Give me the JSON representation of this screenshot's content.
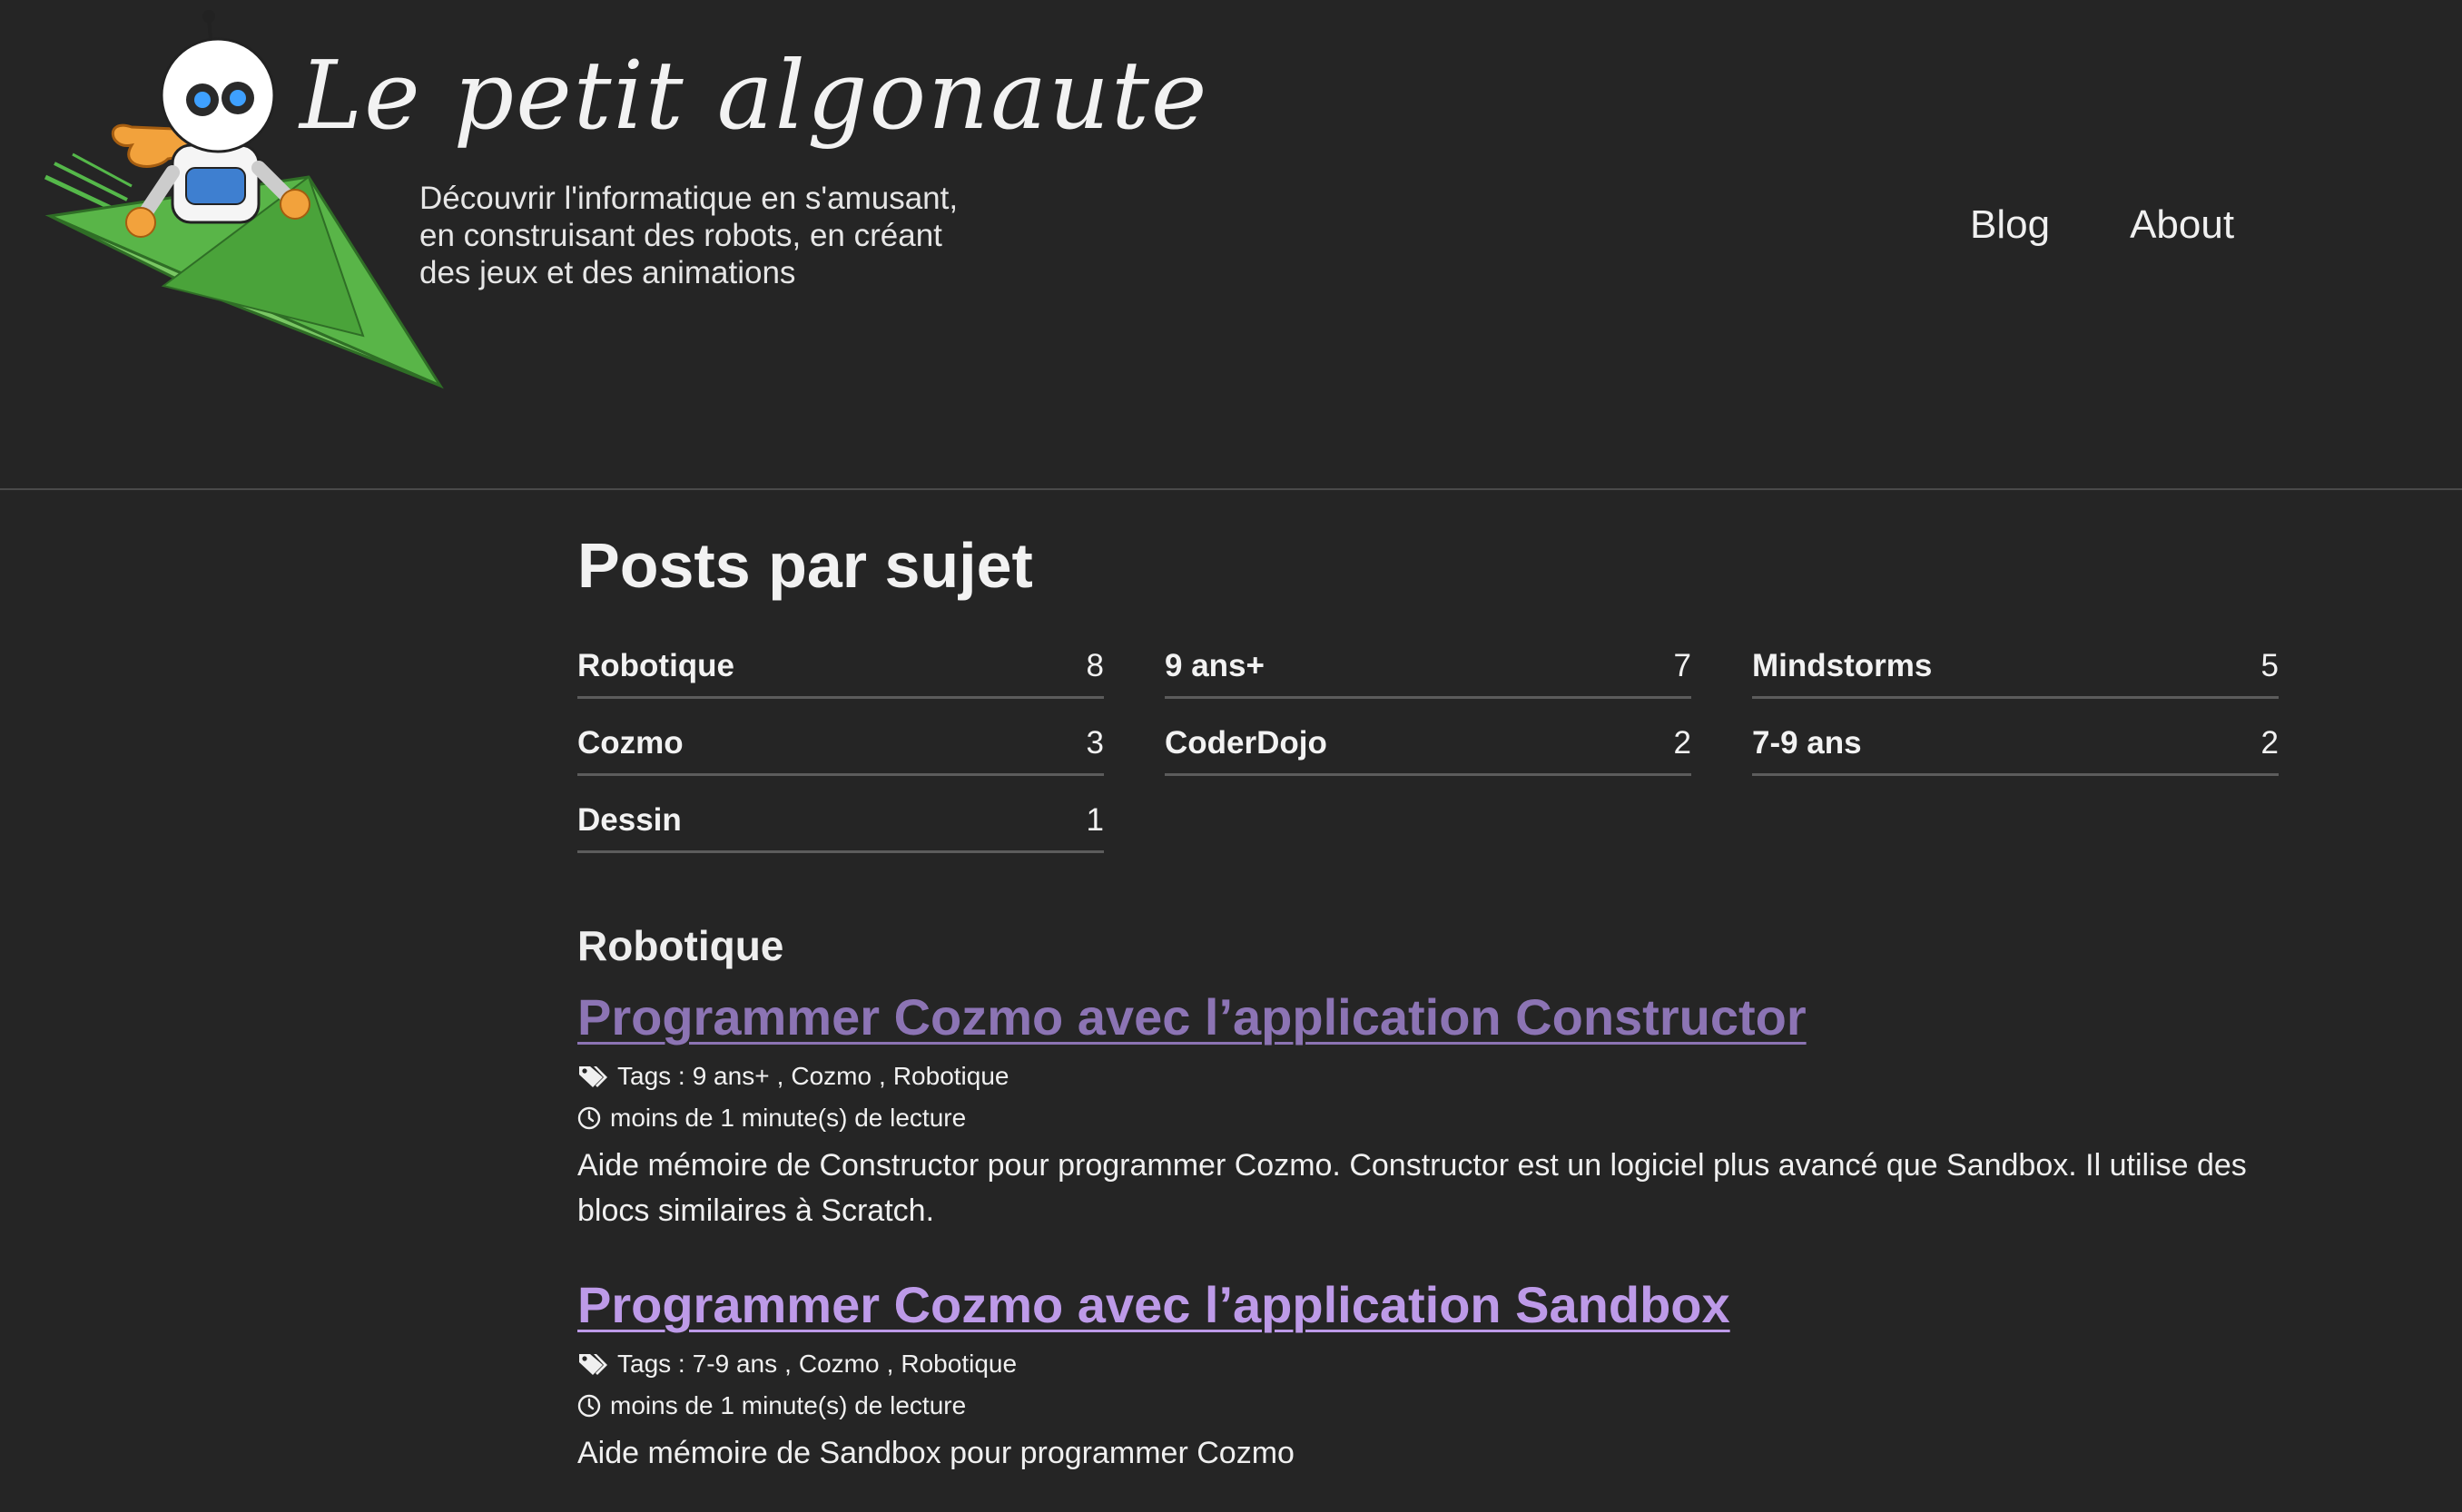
{
  "site": {
    "title": "Le petit algonaute",
    "tagline_lines": [
      "Découvrir l'informatique en s'amusant,",
      "en construisant des robots, en créant",
      "des jeux et des animations"
    ]
  },
  "nav": {
    "items": [
      {
        "label": "Blog"
      },
      {
        "label": "About"
      }
    ]
  },
  "page": {
    "title": "Posts par sujet"
  },
  "tags": [
    {
      "name": "Robotique",
      "count": "8"
    },
    {
      "name": "9 ans+",
      "count": "7"
    },
    {
      "name": "Mindstorms",
      "count": "5"
    },
    {
      "name": "Cozmo",
      "count": "3"
    },
    {
      "name": "CoderDojo",
      "count": "2"
    },
    {
      "name": "7-9 ans",
      "count": "2"
    },
    {
      "name": "Dessin",
      "count": "1"
    }
  ],
  "section": {
    "heading": "Robotique"
  },
  "posts": [
    {
      "title": "Programmer Cozmo avec l’application Constructor",
      "title_color": "#8c74b4",
      "tags_label": "Tags :",
      "tags": [
        "9 ans+",
        "Cozmo",
        "Robotique"
      ],
      "reading_time": "moins de 1 minute(s) de lecture",
      "excerpt": "Aide mémoire de Constructor pour programmer Cozmo. Constructor est un logiciel plus avancé que Sandbox. Il utilise des blocs similaires à Scratch."
    },
    {
      "title": "Programmer Cozmo avec l’application Sandbox",
      "title_color": "#bd9ae8",
      "tags_label": "Tags :",
      "tags": [
        "7-9 ans",
        "Cozmo",
        "Robotique"
      ],
      "reading_time": "moins de 1 minute(s) de lecture",
      "excerpt": "Aide mémoire de Sandbox pour programmer Cozmo"
    }
  ],
  "colors": {
    "background": "#252525",
    "text": "#eeeeee",
    "divider": "#5c5c5c",
    "link_visited": "#8c74b4",
    "link": "#bd9ae8"
  }
}
